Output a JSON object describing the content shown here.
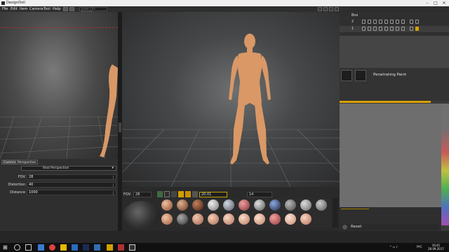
{
  "window": {
    "title": "DesignDoll"
  },
  "menu": [
    "File",
    "Edit",
    "Item",
    "Camera",
    "Tool",
    "Help"
  ],
  "search": {
    "placeholder": "Enter Ctrl-Activate"
  },
  "camera_panel": {
    "tabs": [
      "Camera",
      "Perspective"
    ],
    "projection": "Real Perspective",
    "fields": [
      {
        "label": "FOV",
        "value": "28"
      },
      {
        "label": "Distortion",
        "value": "40"
      },
      {
        "label": "Distance",
        "value": "1000"
      }
    ]
  },
  "bottom_toolbar": {
    "fov_label": "FOV",
    "fov_value": "28",
    "value_a": "20.01",
    "value_b": "14"
  },
  "layers": [
    {
      "name": "Box"
    },
    {
      "name": "2"
    },
    {
      "name": "1"
    }
  ],
  "brush": {
    "name": "Penetrating Paint"
  },
  "reset_label": "Reset",
  "clock": {
    "time": "16:41",
    "date": "28.09.2017"
  },
  "tray_lang": "РУС",
  "colors": {
    "accent_yellow": "#d8a000",
    "figure": "#d99866",
    "background": "#2b2b2b"
  }
}
